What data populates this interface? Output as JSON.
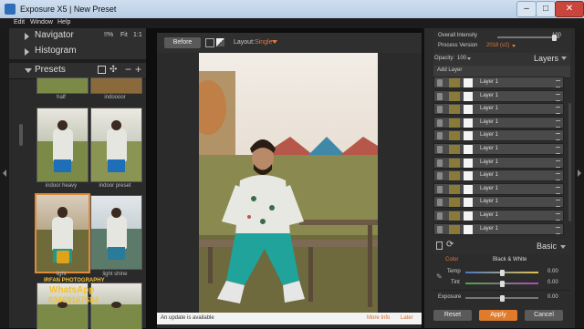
{
  "window": {
    "title": "Exposure X5 | New Preset"
  },
  "menu": [
    "Edit",
    "Window",
    "Help"
  ],
  "left": {
    "navigator": {
      "label": "Navigator",
      "zoom_info": "!!%",
      "fit": "Fit",
      "ratio": "1:1"
    },
    "histogram": {
      "label": "Histogram"
    },
    "presets": {
      "label": "Presets",
      "plus": "+",
      "minus": "−"
    },
    "thumbs": [
      {
        "label": "half"
      },
      {
        "label": "indoooor"
      },
      {
        "label": "indoor heavy"
      },
      {
        "label": "indoor preset"
      },
      {
        "label": "light"
      },
      {
        "label": "light shine"
      }
    ],
    "watermark": {
      "brand": "IRFAN",
      "suffix": "PHOTOGRAPHY",
      "app": "WhatsApp",
      "phone": "03469167684"
    }
  },
  "center": {
    "before_label": "Before",
    "layout_label": "Layout:",
    "layout_value": "Single",
    "status_text": "An update is available",
    "more_info": "More Info",
    "later": "Later"
  },
  "right": {
    "overall_intensity": {
      "label": "Overall Intensity",
      "value": "100",
      "level": 1.0
    },
    "process_version": {
      "label": "Process Version",
      "value": "2018 (v2)"
    },
    "opacity": {
      "label": "Opacity:",
      "value": "100"
    },
    "layers_title": "Layers",
    "add_layer": "Add Layer",
    "layers": [
      "Layer 1",
      "Layer 1",
      "Layer 1",
      "Layer 1",
      "Layer 1",
      "Layer 1",
      "Layer 1",
      "Layer 1",
      "Layer 1",
      "Layer 1",
      "Layer 1",
      "Layer 1"
    ],
    "basic_title": "Basic",
    "color_tab": "Color",
    "bw_tab": "Black & White",
    "temp": {
      "label": "Temp",
      "value": "0.00"
    },
    "tint": {
      "label": "Tint",
      "value": "0.00"
    },
    "exposure": {
      "label": "Exposure",
      "value": "0.00"
    },
    "reset": "Reset",
    "apply": "Apply",
    "cancel": "Cancel"
  },
  "colors": {
    "accent": "#e08a3a",
    "layout_value": "#e07a3a",
    "apply_button": "#e07b2e"
  }
}
